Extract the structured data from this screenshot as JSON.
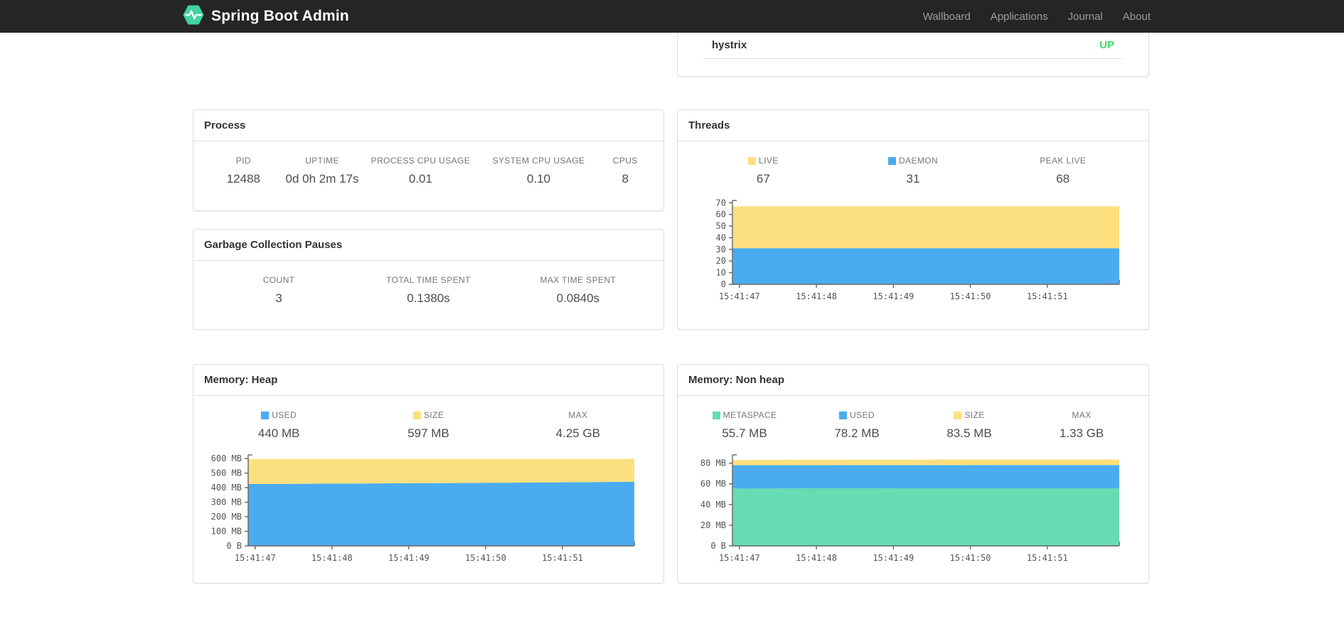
{
  "navbar": {
    "brand": "Spring Boot Admin",
    "logo_icon": "pulse-hexagon-icon",
    "logo_color": "#42d3a5",
    "links": [
      {
        "label": "Wallboard"
      },
      {
        "label": "Applications"
      },
      {
        "label": "Journal"
      },
      {
        "label": "About"
      }
    ]
  },
  "status_panel": {
    "application": "hystrix",
    "status": "UP",
    "status_color": "#42d96a"
  },
  "panels": {
    "process": {
      "title": "Process",
      "stats": [
        {
          "label": "PID",
          "value": "12488"
        },
        {
          "label": "UPTIME",
          "value": "0d 0h 2m 17s"
        },
        {
          "label": "PROCESS CPU USAGE",
          "value": "0.01"
        },
        {
          "label": "SYSTEM CPU USAGE",
          "value": "0.10"
        },
        {
          "label": "CPUS",
          "value": "8"
        }
      ]
    },
    "gc": {
      "title": "Garbage Collection Pauses",
      "stats": [
        {
          "label": "COUNT",
          "value": "3"
        },
        {
          "label": "TOTAL TIME SPENT",
          "value": "0.1380s"
        },
        {
          "label": "MAX TIME SPENT",
          "value": "0.0840s"
        }
      ]
    },
    "threads": {
      "title": "Threads",
      "stats": [
        {
          "label": "LIVE",
          "value": "67",
          "color": "#fce07f"
        },
        {
          "label": "DAEMON",
          "value": "31",
          "color": "#4aacee"
        },
        {
          "label": "PEAK LIVE",
          "value": "68"
        }
      ]
    },
    "heap": {
      "title": "Memory: Heap",
      "stats": [
        {
          "label": "USED",
          "value": "440 MB",
          "color": "#4aacee"
        },
        {
          "label": "SIZE",
          "value": "597 MB",
          "color": "#fce07f"
        },
        {
          "label": "MAX",
          "value": "4.25 GB"
        }
      ]
    },
    "nonheap": {
      "title": "Memory: Non heap",
      "stats": [
        {
          "label": "METASPACE",
          "value": "55.7 MB",
          "color": "#66dcb2"
        },
        {
          "label": "USED",
          "value": "78.2 MB",
          "color": "#4aacee"
        },
        {
          "label": "SIZE",
          "value": "83.5 MB",
          "color": "#fce07f"
        },
        {
          "label": "MAX",
          "value": "1.33 GB"
        }
      ]
    }
  },
  "chart_data": [
    {
      "type": "area",
      "title": "Threads",
      "stacked": true,
      "note": "series values are cumulative stack tops sampled evenly over time",
      "x": [
        "15:41:47",
        "15:41:48",
        "15:41:49",
        "15:41:50",
        "15:41:51"
      ],
      "ylim": [
        0,
        72
      ],
      "grid": false,
      "legend_position": "above-chart",
      "y_ticks": [
        {
          "v": 0,
          "label": "0"
        },
        {
          "v": 10,
          "label": "10"
        },
        {
          "v": 20,
          "label": "20"
        },
        {
          "v": 30,
          "label": "30"
        },
        {
          "v": 40,
          "label": "40"
        },
        {
          "v": 50,
          "label": "50"
        },
        {
          "v": 60,
          "label": "60"
        },
        {
          "v": 70,
          "label": "70"
        }
      ],
      "series": [
        {
          "name": "DAEMON",
          "color": "#4aacee",
          "tops": [
            31,
            31,
            31,
            31,
            31,
            31,
            31,
            31,
            31,
            31
          ]
        },
        {
          "name": "LIVE",
          "color": "#fce07f",
          "tops": [
            67,
            67,
            67,
            67,
            67,
            67,
            67,
            67,
            67,
            67
          ]
        }
      ]
    },
    {
      "type": "area",
      "title": "Memory: Heap (MB)",
      "stacked": true,
      "note": "series values are cumulative stack tops in MB sampled evenly over time",
      "x": [
        "15:41:47",
        "15:41:48",
        "15:41:49",
        "15:41:50",
        "15:41:51"
      ],
      "ylim": [
        0,
        625
      ],
      "grid": false,
      "legend_position": "above-chart",
      "y_ticks": [
        {
          "v": 0,
          "label": "0 B"
        },
        {
          "v": 100,
          "label": "100 MB"
        },
        {
          "v": 200,
          "label": "200 MB"
        },
        {
          "v": 300,
          "label": "300 MB"
        },
        {
          "v": 400,
          "label": "400 MB"
        },
        {
          "v": 500,
          "label": "500 MB"
        },
        {
          "v": 600,
          "label": "600 MB"
        }
      ],
      "series": [
        {
          "name": "USED",
          "color": "#4aacee",
          "tops": [
            425,
            426,
            428,
            429,
            431,
            432,
            434,
            436,
            438,
            441
          ]
        },
        {
          "name": "SIZE",
          "color": "#fce07f",
          "tops": [
            597,
            597,
            597,
            597,
            597,
            597,
            597,
            597,
            597,
            597
          ]
        }
      ]
    },
    {
      "type": "area",
      "title": "Memory: Non heap (MB)",
      "stacked": true,
      "note": "series values are cumulative stack tops in MB sampled evenly over time",
      "x": [
        "15:41:47",
        "15:41:48",
        "15:41:49",
        "15:41:50",
        "15:41:51"
      ],
      "ylim": [
        0,
        88
      ],
      "grid": false,
      "legend_position": "above-chart",
      "y_ticks": [
        {
          "v": 0,
          "label": "0 B"
        },
        {
          "v": 20,
          "label": "20 MB"
        },
        {
          "v": 40,
          "label": "40 MB"
        },
        {
          "v": 60,
          "label": "60 MB"
        },
        {
          "v": 80,
          "label": "80 MB"
        }
      ],
      "series": [
        {
          "name": "METASPACE",
          "color": "#66dcb2",
          "tops": [
            55.4,
            55.5,
            55.6,
            55.6,
            55.7,
            55.7,
            55.7,
            55.7,
            55.7,
            55.7
          ]
        },
        {
          "name": "USED",
          "color": "#4aacee",
          "tops": [
            78.0,
            78.0,
            78.0,
            78.1,
            78.1,
            78.1,
            78.2,
            78.2,
            78.2,
            78.2
          ]
        },
        {
          "name": "SIZE",
          "color": "#fce07f",
          "tops": [
            82.9,
            83.3,
            83.4,
            83.4,
            83.4,
            83.5,
            83.5,
            83.5,
            83.5,
            83.5
          ]
        }
      ]
    }
  ]
}
